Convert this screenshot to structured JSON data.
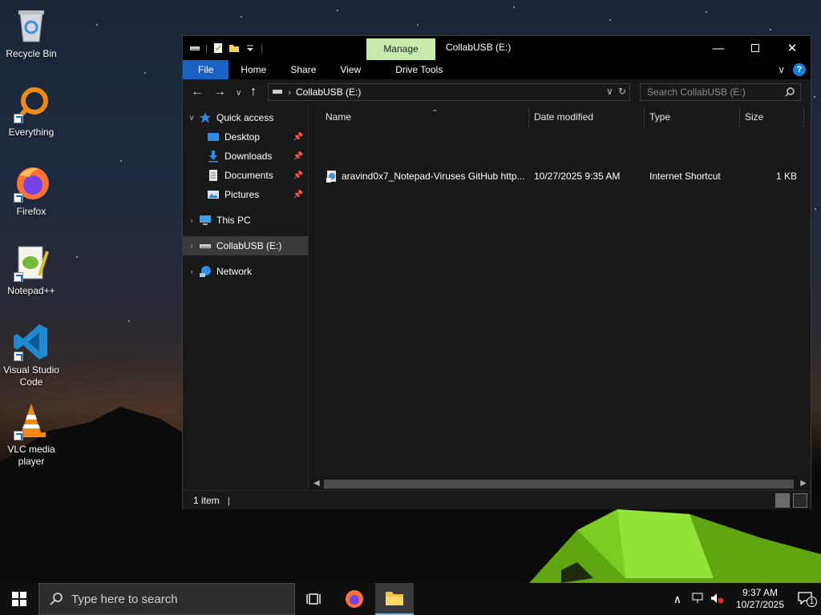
{
  "desktop": {
    "icons": [
      {
        "label": "Recycle Bin"
      },
      {
        "label": "Everything"
      },
      {
        "label": "Firefox"
      },
      {
        "label": "Notepad++"
      },
      {
        "label": "Visual Studio Code"
      },
      {
        "label": "VLC media player"
      }
    ]
  },
  "explorer": {
    "title": "CollabUSB (E:)",
    "manage_tab": "Manage",
    "ribbon_tabs": [
      "File",
      "Home",
      "Share",
      "View",
      "Drive Tools"
    ],
    "address": {
      "path": "CollabUSB (E:)"
    },
    "search": {
      "placeholder": "Search CollabUSB (E:)"
    },
    "nav": {
      "quick_access": "Quick access",
      "desktop": "Desktop",
      "downloads": "Downloads",
      "documents": "Documents",
      "pictures": "Pictures",
      "this_pc": "This PC",
      "collabusb": "CollabUSB (E:)",
      "network": "Network"
    },
    "columns": {
      "name": "Name",
      "date": "Date modified",
      "type": "Type",
      "size": "Size"
    },
    "files": [
      {
        "name": "aravind0x7_Notepad-Viruses GitHub http...",
        "date": "10/27/2025 9:35 AM",
        "type": "Internet Shortcut",
        "size": "1 KB"
      }
    ],
    "status": {
      "item_count": "1 item"
    }
  },
  "taskbar": {
    "search_placeholder": "Type here to search",
    "clock_time": "9:37 AM",
    "clock_date": "10/27/2025",
    "notification_count": "1"
  },
  "colors": {
    "file_tab": "#1b62c5",
    "manage_tab": "#c5ecac",
    "window_bg": "#191919",
    "taskbar_bg": "#101010"
  }
}
